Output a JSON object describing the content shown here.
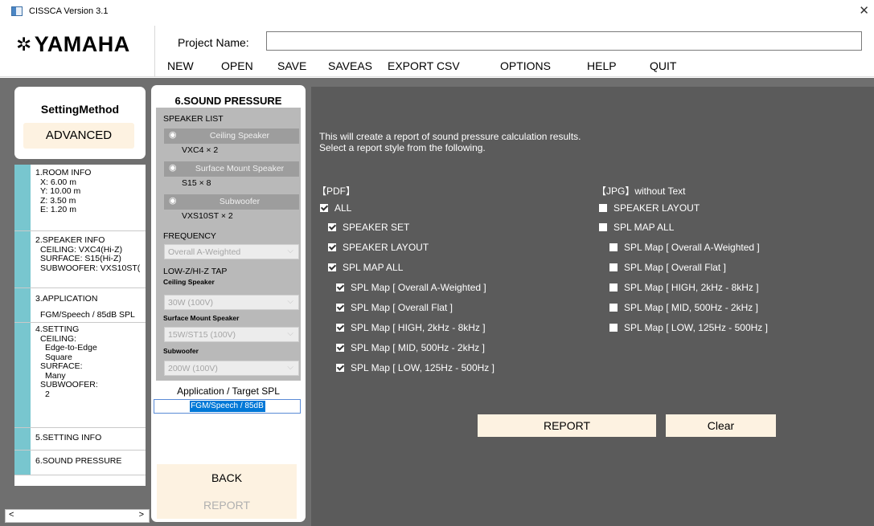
{
  "window": {
    "title": "CISSCA Version 3.1",
    "close_glyph": "✕"
  },
  "logo": {
    "mark": "✲",
    "text": "YAMAHA"
  },
  "project": {
    "label": "Project Name:",
    "value": ""
  },
  "menu": [
    {
      "label": "NEW"
    },
    {
      "label": "OPEN"
    },
    {
      "label": "SAVE"
    },
    {
      "label": "SAVEAS"
    },
    {
      "label": "EXPORT CSV"
    },
    {
      "label": "OPTIONS"
    },
    {
      "label": "HELP"
    },
    {
      "label": "QUIT"
    }
  ],
  "setting": {
    "title": "SettingMethod",
    "mode": "ADVANCED"
  },
  "steps": {
    "room": {
      "title": "1.ROOM INFO",
      "lines": [
        "X: 6.00 m",
        "Y: 10.00 m",
        "Z: 3.50 m",
        "E: 1.20 m"
      ]
    },
    "speaker": {
      "title": "2.SPEAKER INFO",
      "lines": [
        "CEILING: VXC4(Hi-Z)",
        "SURFACE: S15(Hi-Z)",
        "SUBWOOFER: VXS10ST("
      ]
    },
    "application": {
      "title": "3.APPLICATION",
      "value": "FGM/Speech / 85dB SPL"
    },
    "setting": {
      "title": "4.SETTING",
      "lines": [
        "CEILING:",
        "Edge-to-Edge",
        "Square",
        "SURFACE:",
        "Many",
        "SUBWOOFER:",
        "2"
      ]
    },
    "setting_info": {
      "title": "5.SETTING INFO"
    },
    "sound_pressure": {
      "title": "6.SOUND PRESSURE"
    }
  },
  "scroll": {
    "left": "<",
    "right": ">"
  },
  "mid": {
    "title": "6.SOUND PRESSURE",
    "speaker_list_label": "SPEAKER LIST",
    "speakers": [
      {
        "name": "Ceiling Speaker",
        "value": "VXC4 × 2"
      },
      {
        "name": "Surface Mount Speaker",
        "value": "S15 × 8"
      },
      {
        "name": "Subwoofer",
        "value": "VXS10ST × 2"
      }
    ],
    "eye_glyph": "◉",
    "frequency_label": "FREQUENCY",
    "frequency_value": "Overall A-Weighted",
    "tap_label": "LOW-Z/HI-Z TAP",
    "taps": [
      {
        "label": "Ceiling Speaker",
        "value": "30W (100V)"
      },
      {
        "label": "Surface Mount Speaker",
        "value": "15W/ST15 (100V)"
      },
      {
        "label": "Subwoofer",
        "value": "200W (100V)"
      }
    ],
    "chevron": "⌵",
    "app_target_label": "Application / Target SPL",
    "app_target_value": "FGM/Speech / 85dB",
    "back": "BACK",
    "report": "REPORT"
  },
  "main": {
    "intro1": "This will create a report of sound pressure calculation results.",
    "intro2": "Select a report style from the following.",
    "pdf_header": "【PDF】",
    "jpg_header": "【JPG】without Text",
    "pdf": [
      {
        "label": "ALL",
        "checked": true
      },
      {
        "label": "SPEAKER SET",
        "checked": true
      },
      {
        "label": "SPEAKER LAYOUT",
        "checked": true
      },
      {
        "label": "SPL MAP ALL",
        "checked": true
      },
      {
        "label": "SPL Map [ Overall A-Weighted ]",
        "checked": true
      },
      {
        "label": "SPL Map [ Overall Flat ]",
        "checked": true
      },
      {
        "label": "SPL Map [ HIGH, 2kHz - 8kHz ]",
        "checked": true
      },
      {
        "label": "SPL Map [ MID, 500Hz - 2kHz ]",
        "checked": true
      },
      {
        "label": "SPL Map [ LOW, 125Hz - 500Hz ]",
        "checked": true
      }
    ],
    "jpg": [
      {
        "label": "SPEAKER LAYOUT",
        "checked": false
      },
      {
        "label": "SPL MAP ALL",
        "checked": false
      },
      {
        "label": "SPL Map [ Overall A-Weighted ]",
        "checked": false
      },
      {
        "label": "SPL Map [ Overall Flat ]",
        "checked": false
      },
      {
        "label": "SPL Map [ HIGH, 2kHz - 8kHz ]",
        "checked": false
      },
      {
        "label": "SPL Map [ MID, 500Hz - 2kHz ]",
        "checked": false
      },
      {
        "label": "SPL Map [ LOW, 125Hz - 500Hz ]",
        "checked": false
      }
    ],
    "report": "REPORT",
    "clear": "Clear"
  }
}
